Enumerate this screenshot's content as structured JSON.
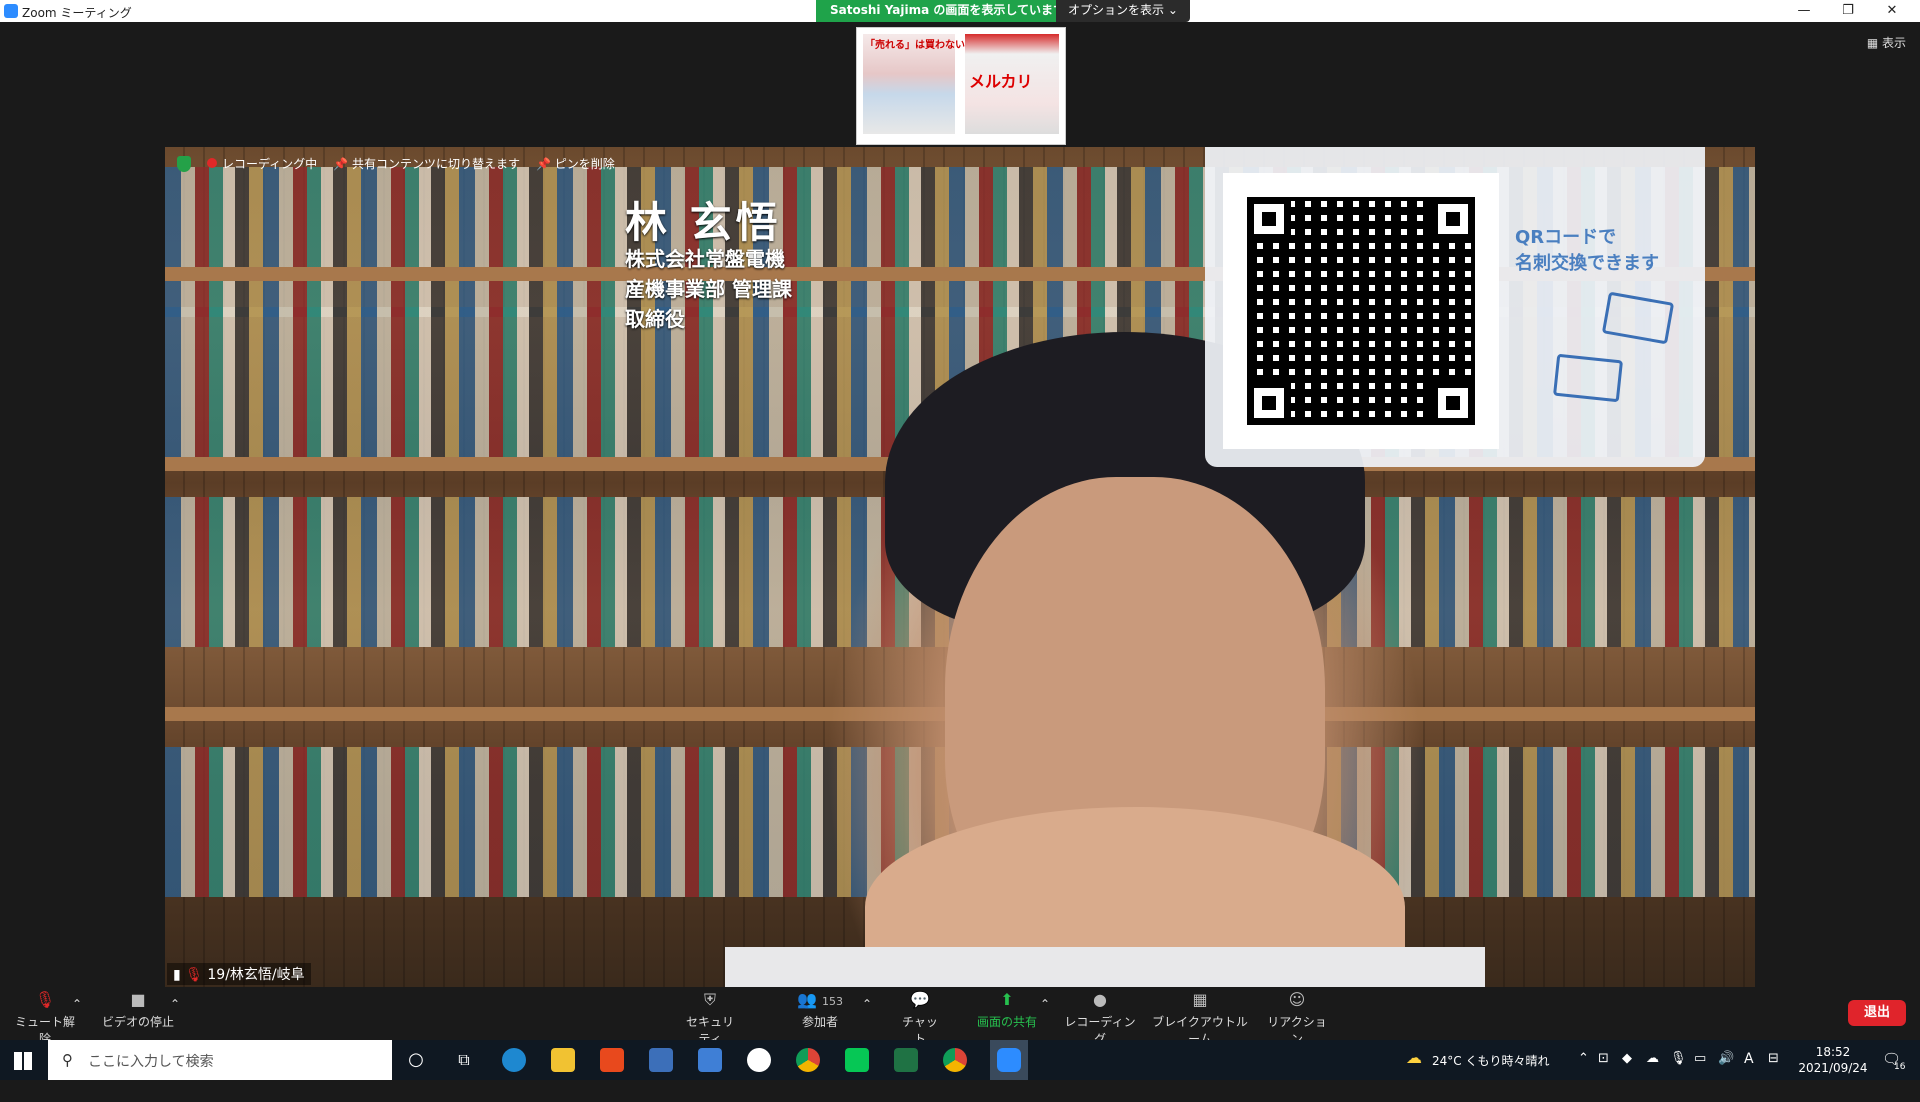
{
  "window": {
    "title": "Zoom ミーティング",
    "share_banner": "Satoshi  Yajima の画面を表示しています",
    "options_label": "オプションを表示 ⌄",
    "view_label": "表示",
    "minimize": "—",
    "restore": "❐",
    "close": "✕"
  },
  "share_thumbnail": {
    "text_left": "「売れる」は買わない",
    "text_right": "メルカリ"
  },
  "video_overlay": {
    "recording": "レコーディング中",
    "switch_to_shared": "共有コンテンツに切り替えます",
    "remove_pin": "ピンを削除"
  },
  "virtual_background": {
    "name": "林 玄悟",
    "company": "株式会社常盤電機",
    "department": "産機事業部 管理課",
    "position": "取締役",
    "qr_caption_line1": "QRコードで",
    "qr_caption_line2": "名刺交換できます"
  },
  "participant_tag": "19/林玄悟/岐阜",
  "toolbar": {
    "mute": "ミュート解除",
    "video": "ビデオの停止",
    "security": "セキュリティ",
    "participants": "参加者",
    "participant_count": "153",
    "chat": "チャット",
    "share": "画面の共有",
    "record": "レコーディング",
    "breakout": "ブレイクアウトルーム",
    "reactions": "リアクション",
    "leave": "退出"
  },
  "taskbar": {
    "search_placeholder": "ここに入力して検索",
    "weather": "24°C くもり時々晴れ",
    "time": "18:52",
    "date": "2021/09/24",
    "ime": "A",
    "notification_count": "16"
  },
  "colors": {
    "share_green": "#1fa34a",
    "leave_red": "#e0242b",
    "zoom_blue": "#2d8cff"
  }
}
